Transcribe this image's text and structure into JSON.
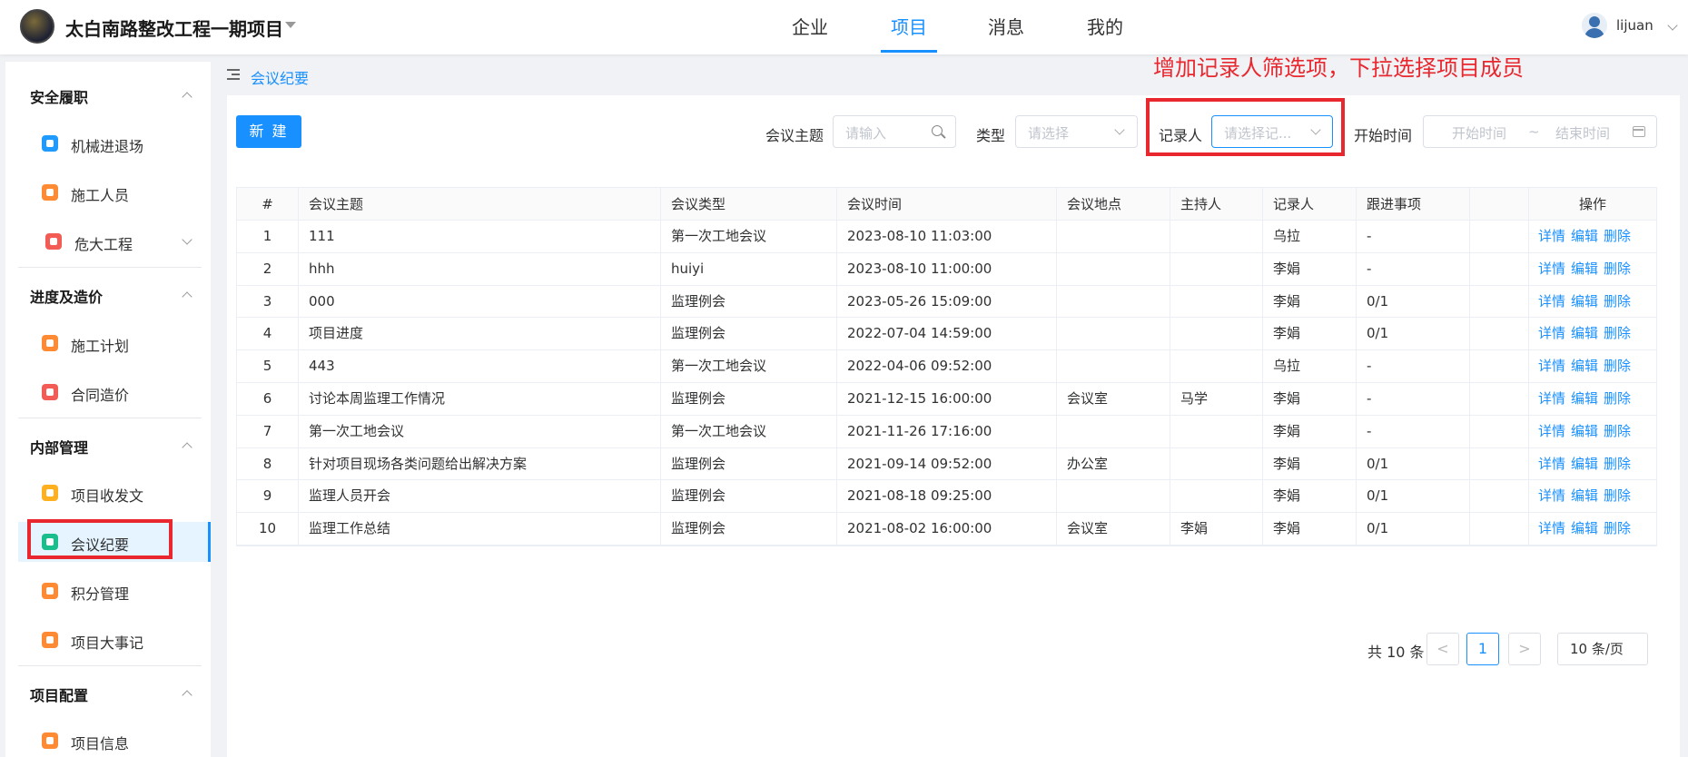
{
  "header": {
    "project_title": "太白南路整改工程一期项目",
    "tabs": [
      {
        "label": "企业",
        "active": false
      },
      {
        "label": "项目",
        "active": true
      },
      {
        "label": "消息",
        "active": false
      },
      {
        "label": "我的",
        "active": false
      }
    ],
    "username": "lijuan",
    "accent_color": "#1890ff"
  },
  "sidebar": {
    "sections": [
      {
        "title": "安全履职",
        "items": [
          {
            "label": "机械进退场",
            "icon": "machinery-icon",
            "color": "#1f9bff"
          },
          {
            "label": "施工人员",
            "icon": "worker-icon",
            "color": "#ff8a34"
          },
          {
            "label": "危大工程",
            "icon": "hazard-icon",
            "color": "#f25c54",
            "expandable": true
          }
        ]
      },
      {
        "title": "进度及造价",
        "items": [
          {
            "label": "施工计划",
            "icon": "plan-icon",
            "color": "#ff8a34"
          },
          {
            "label": "合同造价",
            "icon": "contract-icon",
            "color": "#f25c54"
          }
        ]
      },
      {
        "title": "内部管理",
        "items": [
          {
            "label": "项目收发文",
            "icon": "document-icon",
            "color": "#ffb020"
          },
          {
            "label": "会议纪要",
            "icon": "meeting-icon",
            "color": "#19be8c",
            "active": true
          },
          {
            "label": "积分管理",
            "icon": "points-icon",
            "color": "#ff8a34"
          },
          {
            "label": "项目大事记",
            "icon": "milestone-icon",
            "color": "#ff8a34"
          }
        ]
      },
      {
        "title": "项目配置",
        "items": [
          {
            "label": "项目信息",
            "icon": "project-info-icon",
            "color": "#ff8a34"
          }
        ]
      }
    ]
  },
  "breadcrumb": "会议纪要",
  "toolbar": {
    "new_label": "新 建",
    "topic_label": "会议主题",
    "topic_placeholder": "请输入",
    "type_label": "类型",
    "type_placeholder": "请选择",
    "recorder_label": "记录人",
    "recorder_placeholder": "请选择记...",
    "start_label": "开始时间",
    "start_placeholder": "开始时间",
    "range_sep": "~",
    "end_placeholder": "结束时间"
  },
  "annotation": {
    "text": "增加记录人筛选项，下拉选择项目成员",
    "color": "#e8272e"
  },
  "table": {
    "columns": [
      "#",
      "会议主题",
      "会议类型",
      "会议时间",
      "会议地点",
      "主持人",
      "记录人",
      "跟进事项",
      "",
      "操作"
    ],
    "actions": [
      "详情",
      "编辑",
      "删除"
    ],
    "rows": [
      [
        "1",
        "111",
        "第一次工地会议",
        "2023-08-10 11:03:00",
        "",
        "",
        "乌拉",
        "-"
      ],
      [
        "2",
        "hhh",
        "huiyi",
        "2023-08-10 11:00:00",
        "",
        "",
        "李娟",
        "-"
      ],
      [
        "3",
        "000",
        "监理例会",
        "2023-05-26 15:09:00",
        "",
        "",
        "李娟",
        "0/1"
      ],
      [
        "4",
        "项目进度",
        "监理例会",
        "2022-07-04 14:59:00",
        "",
        "",
        "李娟",
        "0/1"
      ],
      [
        "5",
        "443",
        "第一次工地会议",
        "2022-04-06 09:52:00",
        "",
        "",
        "乌拉",
        "-"
      ],
      [
        "6",
        "讨论本周监理工作情况",
        "监理例会",
        "2021-12-15 16:00:00",
        "会议室",
        "马学",
        "李娟",
        "-"
      ],
      [
        "7",
        "第一次工地会议",
        "第一次工地会议",
        "2021-11-26 17:16:00",
        "",
        "",
        "李娟",
        "-"
      ],
      [
        "8",
        "针对项目现场各类问题给出解决方案",
        "监理例会",
        "2021-09-14 09:52:00",
        "办公室",
        "",
        "李娟",
        "0/1"
      ],
      [
        "9",
        "监理人员开会",
        "监理例会",
        "2021-08-18 09:25:00",
        "",
        "",
        "李娟",
        "0/1"
      ],
      [
        "10",
        "监理工作总结",
        "监理例会",
        "2021-08-02 16:00:00",
        "会议室",
        "李娟",
        "李娟",
        "0/1"
      ]
    ]
  },
  "pagination": {
    "total_label": "共 10 条",
    "current_page": "1",
    "prev": "<",
    "next": ">",
    "page_size": "10 条/页"
  }
}
